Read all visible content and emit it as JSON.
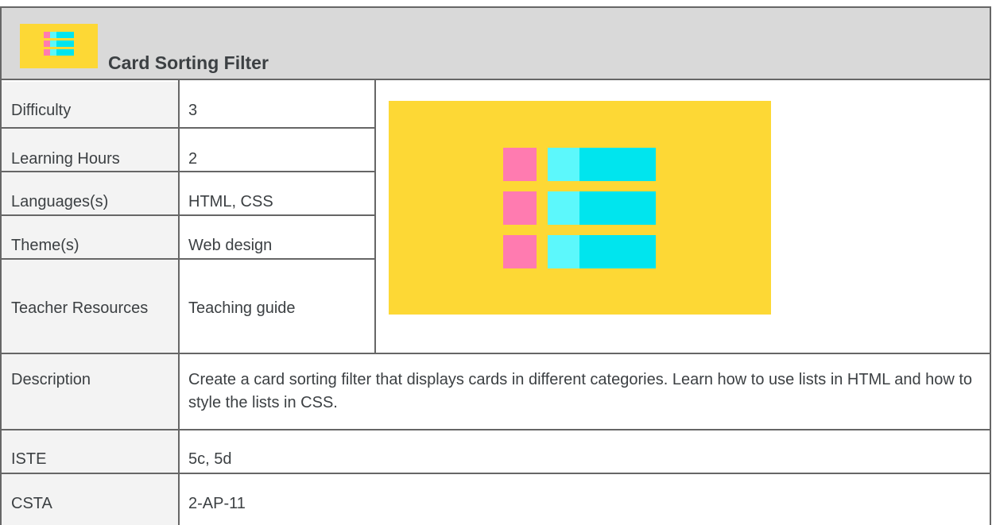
{
  "title": "Card Sorting Filter",
  "icon": "card-list-icon",
  "colors": {
    "header_bg": "#d9d9d9",
    "label_bg": "#f3f3f3",
    "icon_bg": "#fdd835",
    "pink": "#ff7bb0",
    "cyan_light": "#5cf8fc",
    "cyan": "#00e5ee"
  },
  "rows": {
    "difficulty": {
      "label": "Difficulty",
      "value": "3"
    },
    "learning_hours": {
      "label": "Learning Hours",
      "value": "2"
    },
    "languages": {
      "label": "Languages(s)",
      "value": "HTML, CSS"
    },
    "themes": {
      "label": "Theme(s)",
      "value": "Web design"
    },
    "teacher_resources": {
      "label": "Teacher Resources",
      "value": "Teaching guide"
    },
    "description": {
      "label": "Description",
      "value": "Create a card sorting filter that displays cards in different categories. Learn how to use lists in HTML and how to style the lists in CSS."
    },
    "iste": {
      "label": "ISTE",
      "value": "5c, 5d"
    },
    "csta": {
      "label": "CSTA",
      "value": "2-AP-11"
    }
  }
}
